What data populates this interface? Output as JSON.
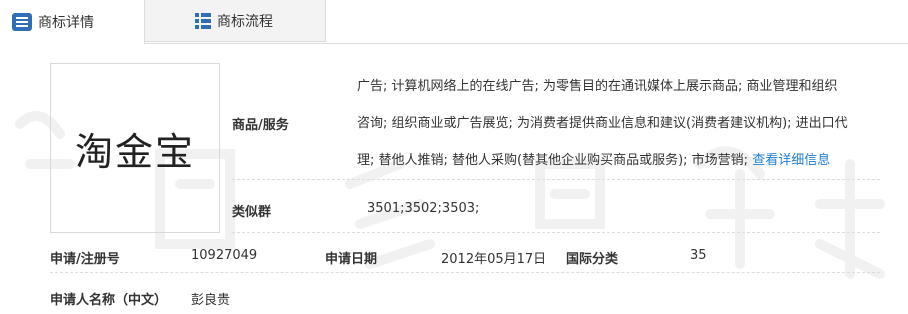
{
  "tabs": [
    {
      "label": "商标详情",
      "active": true,
      "icon": "list-icon"
    },
    {
      "label": "商标流程",
      "active": false,
      "icon": "grid-list-icon"
    }
  ],
  "trademark": {
    "logo_text": "淘金宝"
  },
  "goods_services": {
    "label": "商品/服务",
    "lines": [
      "广告; 计算机网络上的在线广告; 为零售目的在通讯媒体上展示商品; 商业管理和组织",
      "咨询; 组织商业或广告展览; 为消费者提供商业信息和建议(消费者建议机构); 进出口代",
      "理; 替他人推销; 替他人采购(替其他企业购买商品或服务); 市场营销; "
    ],
    "detail_link": "查看详细信息"
  },
  "similar_group": {
    "label": "类似群",
    "value": "3501;3502;3503;"
  },
  "registration": {
    "label": "申请/注册号",
    "value": "10927049"
  },
  "apply_date": {
    "label": "申请日期",
    "value": "2012年05月17日"
  },
  "intl_class": {
    "label": "国际分类",
    "value": "35"
  },
  "applicant": {
    "label": "申请人名称（中文）",
    "value": "彭良贵"
  },
  "colors": {
    "link": "#1e7fd0",
    "watermark": "#f2f2f2",
    "border": "#dcdcdc"
  }
}
